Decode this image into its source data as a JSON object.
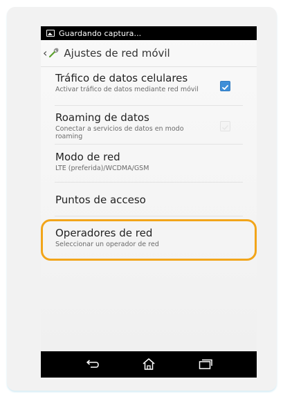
{
  "status_bar": {
    "text": "Guardando captura...",
    "icon": "screenshot-image-icon"
  },
  "action_bar": {
    "title": "Ajustes de red móvil",
    "back_icon": "chevron-left-icon",
    "app_icon": "wrench-icon"
  },
  "settings": [
    {
      "title": "Tráfico de datos celulares",
      "summary": "Activar tráfico de datos mediante red móvil",
      "checkbox": true,
      "checkbox_enabled": true
    },
    {
      "title": "Roaming de datos",
      "summary": "Conectar a servicios de datos en modo roaming",
      "checkbox": false,
      "checkbox_enabled": false
    },
    {
      "title": "Modo de red",
      "summary": "LTE (preferida)/WCDMA/GSM"
    },
    {
      "title": "Puntos de acceso",
      "summary": ""
    },
    {
      "title": "Operadores de red",
      "summary": "Seleccionar un operador de red",
      "highlighted": true
    }
  ],
  "nav_bar": {
    "back_icon": "back-arrow-icon",
    "home_icon": "home-icon",
    "recents_icon": "recent-apps-icon"
  },
  "colors": {
    "highlight": "#f2a51a",
    "checkbox_on": "#3f8fd8"
  }
}
